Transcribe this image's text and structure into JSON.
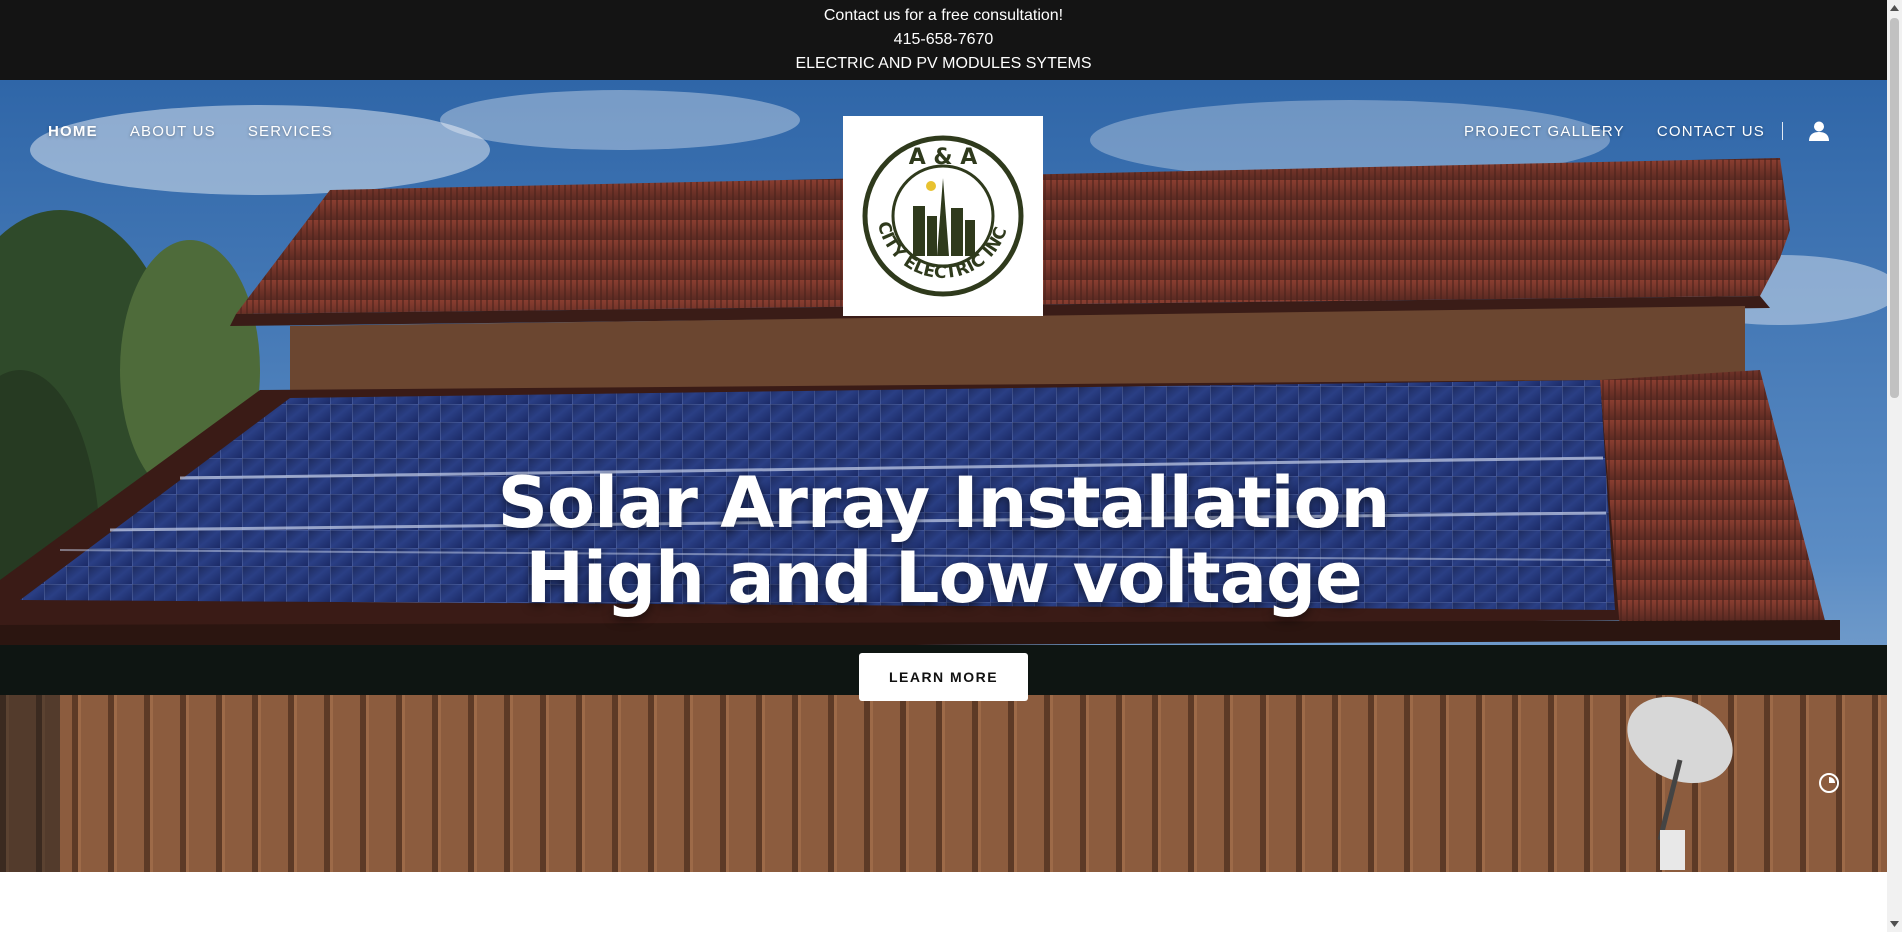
{
  "announcement": {
    "line1": "Contact us for a free consultation!",
    "line2": "415-658-7670",
    "line3": "ELECTRIC AND PV MODULES SYTEMS"
  },
  "nav": {
    "left": [
      {
        "label": "HOME",
        "active": true
      },
      {
        "label": "ABOUT US",
        "active": false
      },
      {
        "label": "SERVICES",
        "active": false
      }
    ],
    "right": [
      {
        "label": "PROJECT GALLERY"
      },
      {
        "label": "CONTACT US"
      }
    ],
    "account_icon": "user-icon"
  },
  "logo": {
    "top_text": "A & A",
    "arc_text": "CITY ELECTRIC INC.",
    "color": "#2f3a1c"
  },
  "hero": {
    "headline_line1": "Solar Array Installation",
    "headline_line2": "High and Low voltage",
    "cta_label": "LEARN MORE"
  },
  "colors": {
    "announce_bg": "#141414",
    "sky": "#3b6ea5",
    "roof": "#7a3a2c",
    "siding": "#8a5a3a",
    "panel": "#1e2e66"
  }
}
